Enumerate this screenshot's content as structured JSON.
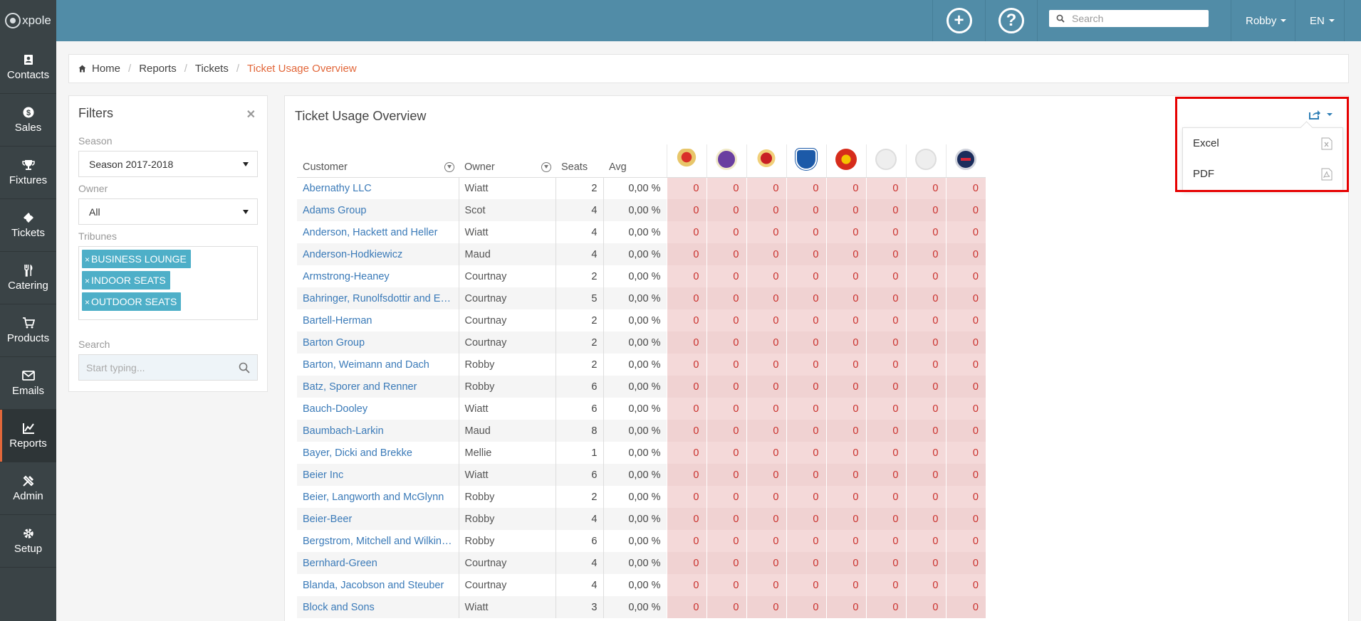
{
  "app": {
    "logo_text": "xpole"
  },
  "sidebar": {
    "items": [
      {
        "label": "Contacts",
        "icon": "contacts-icon"
      },
      {
        "label": "Sales",
        "icon": "dollar-icon"
      },
      {
        "label": "Fixtures",
        "icon": "trophy-icon"
      },
      {
        "label": "Tickets",
        "icon": "ticket-icon"
      },
      {
        "label": "Catering",
        "icon": "cutlery-icon"
      },
      {
        "label": "Products",
        "icon": "cart-icon"
      },
      {
        "label": "Emails",
        "icon": "envelope-icon"
      },
      {
        "label": "Reports",
        "icon": "chart-icon",
        "active": true
      },
      {
        "label": "Admin",
        "icon": "tools-icon"
      },
      {
        "label": "Setup",
        "icon": "gear-icon"
      }
    ]
  },
  "header": {
    "search_placeholder": "Search",
    "user": "Robby",
    "language": "EN"
  },
  "breadcrumb": {
    "home": "Home",
    "reports": "Reports",
    "tickets": "Tickets",
    "current": "Ticket Usage Overview"
  },
  "filters": {
    "title": "Filters",
    "close": "✕",
    "season_label": "Season",
    "season_value": "Season 2017-2018",
    "owner_label": "Owner",
    "owner_value": "All",
    "tribunes_label": "Tribunes",
    "tribunes": [
      "BUSINESS LOUNGE",
      "INDOOR SEATS",
      "OUTDOOR SEATS"
    ],
    "search_label": "Search",
    "search_placeholder": "Start typing..."
  },
  "main": {
    "title": "Ticket Usage Overview",
    "export_menu": {
      "excel": "Excel",
      "pdf": "PDF"
    },
    "columns": {
      "customer": "Customer",
      "owner": "Owner",
      "seats": "Seats",
      "avg": "Avg"
    },
    "opponent_logos": [
      "club-logo-1",
      "club-logo-anderlecht",
      "club-logo-standard",
      "club-logo-genk",
      "club-logo-man-utd",
      "club-logo-placeholder",
      "club-logo-placeholder",
      "club-logo-psg"
    ],
    "rows": [
      {
        "customer": "Abernathy LLC",
        "owner": "Wiatt",
        "seats": "2",
        "avg": "0,00 %"
      },
      {
        "customer": "Adams Group",
        "owner": "Scot",
        "seats": "4",
        "avg": "0,00 %"
      },
      {
        "customer": "Anderson, Hackett and Heller",
        "owner": "Wiatt",
        "seats": "4",
        "avg": "0,00 %"
      },
      {
        "customer": "Anderson-Hodkiewicz",
        "owner": "Maud",
        "seats": "4",
        "avg": "0,00 %"
      },
      {
        "customer": "Armstrong-Heaney",
        "owner": "Courtnay",
        "seats": "2",
        "avg": "0,00 %"
      },
      {
        "customer": "Bahringer, Runolfsdottir and Eff...",
        "owner": "Courtnay",
        "seats": "5",
        "avg": "0,00 %"
      },
      {
        "customer": "Bartell-Herman",
        "owner": "Courtnay",
        "seats": "2",
        "avg": "0,00 %"
      },
      {
        "customer": "Barton Group",
        "owner": "Courtnay",
        "seats": "2",
        "avg": "0,00 %"
      },
      {
        "customer": "Barton, Weimann and Dach",
        "owner": "Robby",
        "seats": "2",
        "avg": "0,00 %"
      },
      {
        "customer": "Batz, Sporer and Renner",
        "owner": "Robby",
        "seats": "6",
        "avg": "0,00 %"
      },
      {
        "customer": "Bauch-Dooley",
        "owner": "Wiatt",
        "seats": "6",
        "avg": "0,00 %"
      },
      {
        "customer": "Baumbach-Larkin",
        "owner": "Maud",
        "seats": "8",
        "avg": "0,00 %"
      },
      {
        "customer": "Bayer, Dicki and Brekke",
        "owner": "Mellie",
        "seats": "1",
        "avg": "0,00 %"
      },
      {
        "customer": "Beier Inc",
        "owner": "Wiatt",
        "seats": "6",
        "avg": "0,00 %"
      },
      {
        "customer": "Beier, Langworth and McGlynn",
        "owner": "Robby",
        "seats": "2",
        "avg": "0,00 %"
      },
      {
        "customer": "Beier-Beer",
        "owner": "Robby",
        "seats": "4",
        "avg": "0,00 %"
      },
      {
        "customer": "Bergstrom, Mitchell and Wilkins...",
        "owner": "Robby",
        "seats": "6",
        "avg": "0,00 %"
      },
      {
        "customer": "Bernhard-Green",
        "owner": "Courtnay",
        "seats": "4",
        "avg": "0,00 %"
      },
      {
        "customer": "Blanda, Jacobson and Steuber",
        "owner": "Courtnay",
        "seats": "4",
        "avg": "0,00 %"
      },
      {
        "customer": "Block and Sons",
        "owner": "Wiatt",
        "seats": "3",
        "avg": "0,00 %"
      }
    ],
    "match_value": "0"
  },
  "colors": {
    "header": "#518ca7",
    "sidebar": "#3a4346",
    "accent": "#e2673a",
    "link": "#3a7ab8",
    "tag": "#4eafc8",
    "cell_bg": "#f4d9d9",
    "cell_text": "#c9302c"
  }
}
